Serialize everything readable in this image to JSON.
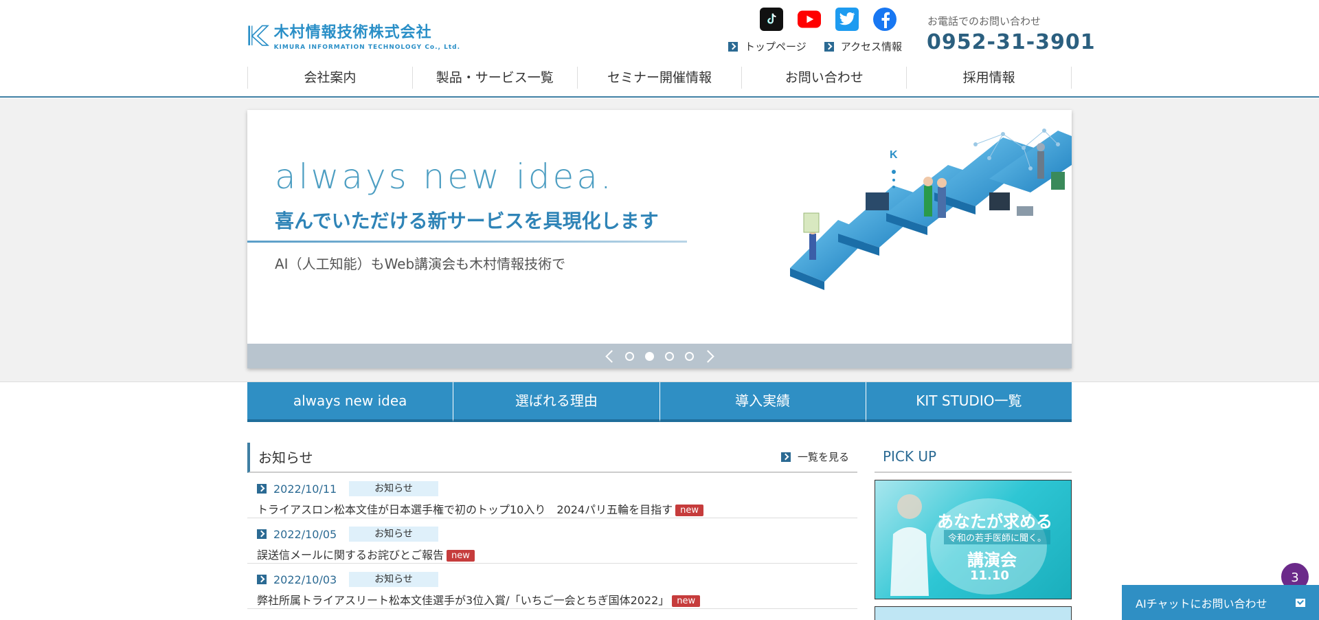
{
  "header": {
    "logo_jp": "木村情報技術株式会社",
    "logo_en": "KIMURA INFORMATION TECHNOLOGY Co., Ltd.",
    "social_icons": [
      "tiktok-icon",
      "youtube-icon",
      "twitter-icon",
      "facebook-icon"
    ],
    "top_links": [
      "トップページ",
      "アクセス情報"
    ],
    "contact_label": "お電話でのお問い合わせ",
    "phone": "0952-31-3901"
  },
  "global_nav": [
    "会社案内",
    "製品・サービス一覧",
    "セミナー開催情報",
    "お問い合わせ",
    "採用情報"
  ],
  "hero": {
    "slogan": "always new idea.",
    "subtitle": "喜んでいただける新サービスを具現化します",
    "small": "AI（人工知能）もWeb講演会も木村情報技術で",
    "slide_count": 4,
    "active_slide": 2
  },
  "feature_nav": [
    "always new idea",
    "選ばれる理由",
    "導入実績",
    "KIT STUDIO一覧"
  ],
  "news": {
    "title": "お知らせ",
    "more_label": "一覧を見る",
    "new_label": "new",
    "items": [
      {
        "date": "2022/10/11",
        "category": "お知らせ",
        "text": "トライアスロン松本文佳が日本選手権で初のトップ10入り　2024パリ五輪を目指す"
      },
      {
        "date": "2022/10/05",
        "category": "お知らせ",
        "text": "誤送信メールに関するお詫びとご報告"
      },
      {
        "date": "2022/10/03",
        "category": "お知らせ",
        "text": "弊社所属トライアスリート松本文佳選手が3位入賞/「いちご一会とちぎ国体2022」"
      }
    ]
  },
  "pickup": {
    "title": "PICK UP",
    "card1": {
      "line1": "あなたが求める",
      "line2": "令和の若手医師に聞く。",
      "line3": "講演会",
      "line4": "11.10"
    }
  },
  "chat": {
    "label": "AIチャットにお問い合わせ",
    "badge": "3"
  }
}
